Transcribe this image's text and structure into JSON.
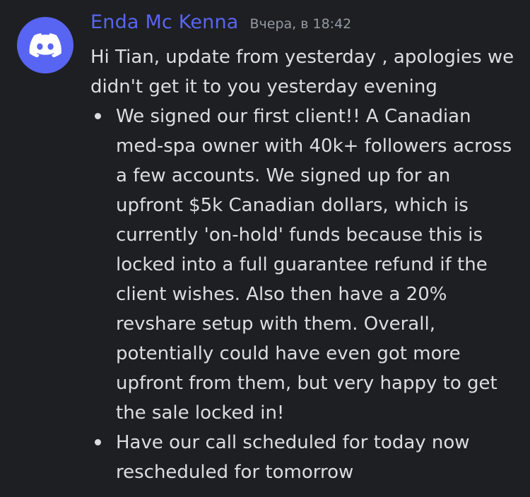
{
  "message": {
    "author": "Enda Mc Kenna",
    "timestamp": "Вчера, в 18:42",
    "avatar_icon": "discord-logo-icon",
    "avatar_color": "#5865f2",
    "username_color": "#5865f2",
    "intro": "Hi Tian, update from yesterday , apologies we didn't get it to you yesterday evening",
    "bullets": [
      "We signed our first client!! A Canadian med-spa owner with 40k+ followers across a few accounts. We signed up for an upfront $5k Canadian dollars, which is currently 'on-hold' funds because this is locked into a full guarantee refund if the client wishes. Also then have a 20% revshare setup with them. Overall, potentially could have even got more upfront from them, but very happy to get the sale locked in!",
      "Have our call scheduled for today now rescheduled for tomorrow"
    ]
  }
}
